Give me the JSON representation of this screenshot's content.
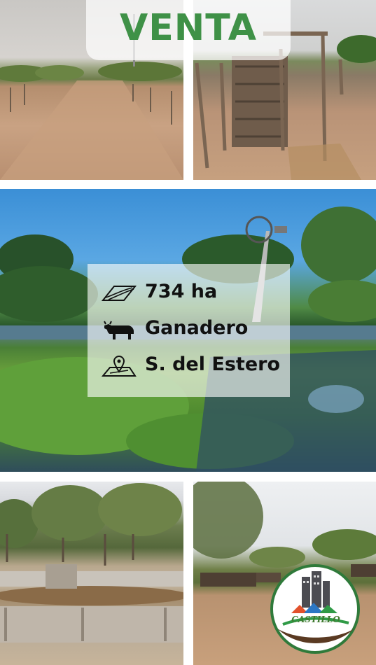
{
  "banner": {
    "title": "VENTA"
  },
  "property": {
    "area": "734 ha",
    "use": "Ganadero",
    "location": "S. del Estero"
  },
  "icons": {
    "area": "field-area-icon",
    "use": "cow-icon",
    "location": "map-pin-icon"
  },
  "logo": {
    "text": "CASTILLO"
  },
  "colors": {
    "accent_green": "#3f9147",
    "text_dark": "#111111"
  }
}
